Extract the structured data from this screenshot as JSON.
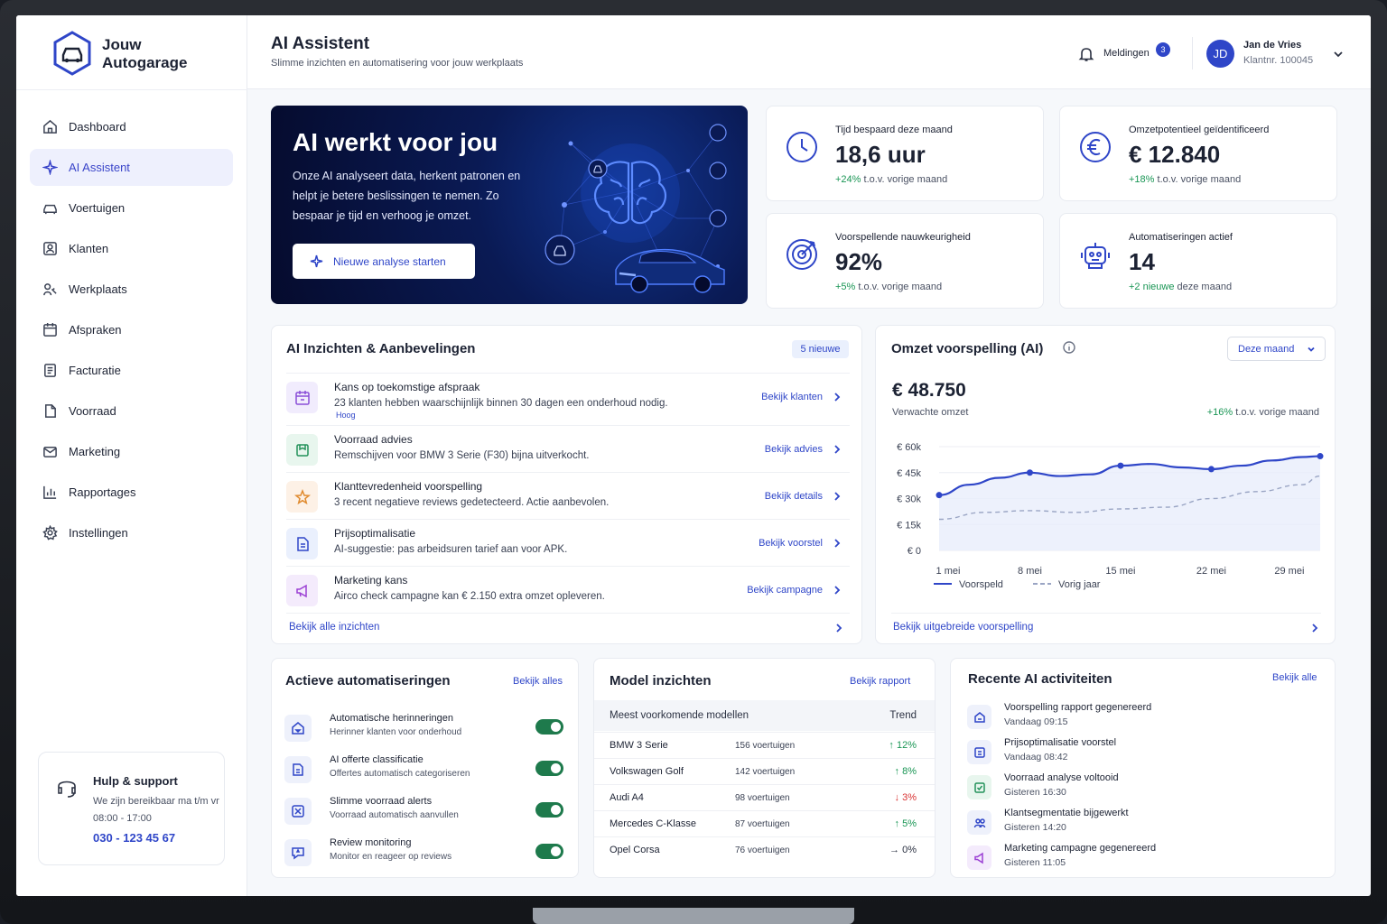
{
  "brand": {
    "line1": "Jouw",
    "line2": "Autogarage"
  },
  "sidebar": {
    "items": [
      {
        "label": "Dashboard",
        "icon": "home-icon"
      },
      {
        "label": "AI Assistent",
        "icon": "sparkle-icon",
        "active": true
      },
      {
        "label": "Voertuigen",
        "icon": "car-icon"
      },
      {
        "label": "Klanten",
        "icon": "customer-card-icon"
      },
      {
        "label": "Werkplaats",
        "icon": "workshop-icon"
      },
      {
        "label": "Afspraken",
        "icon": "calendar-icon"
      },
      {
        "label": "Facturatie",
        "icon": "invoice-icon"
      },
      {
        "label": "Voorraad",
        "icon": "document-icon"
      },
      {
        "label": "Marketing",
        "icon": "mail-icon"
      },
      {
        "label": "Rapportages",
        "icon": "bar-chart-icon"
      },
      {
        "label": "Instellingen",
        "icon": "gear-icon"
      }
    ],
    "help": {
      "title": "Hulp & support",
      "subtitle": "We zijn bereikbaar ma t/m vr 08:00 - 17:00",
      "phone": "030 - 123 45 67"
    }
  },
  "header": {
    "title": "AI Assistent",
    "subtitle": "Slimme inzichten en automatisering voor jouw werkplaats",
    "notifications_label": "Meldingen",
    "notifications_count": "3",
    "user": {
      "initials": "JD",
      "name": "Jan de Vries",
      "customer_no": "Klantnr. 100045"
    }
  },
  "hero": {
    "title": "AI werkt voor jou",
    "text": "Onze AI analyseert data, herkent patronen en helpt je betere beslissingen te nemen. Zo bespaar je tijd en verhoog je omzet.",
    "button": "Nieuwe analyse starten"
  },
  "kpis": [
    {
      "label": "Tijd bespaard deze maand",
      "value": "18,6 uur",
      "delta": "+24%",
      "delta_rest": " t.o.v. vorige maand",
      "icon": "clock-icon"
    },
    {
      "label": "Omzetpotentieel geïdentificeerd",
      "value": "€ 12.840",
      "delta": "+18%",
      "delta_rest": " t.o.v. vorige maand",
      "icon": "euro-icon"
    },
    {
      "label": "Voorspellende nauwkeurigheid",
      "value": "92%",
      "delta": "+5%",
      "delta_rest": " t.o.v. vorige maand",
      "icon": "target-icon"
    },
    {
      "label": "Automatiseringen actief",
      "value": "14",
      "delta": "+2 nieuwe",
      "delta_rest": " deze maand",
      "icon": "robot-icon"
    }
  ],
  "insights": {
    "title": "AI Inzichten & Aanbevelingen",
    "badge": "5 nieuwe",
    "items": [
      {
        "title": "Kans op toekomstige afspraak",
        "desc": "23 klanten hebben waarschijnlijk binnen 30 dagen een onderhoud nodig.",
        "tag": "Hoog",
        "link": "Bekijk klanten",
        "icon": "calendar-icon"
      },
      {
        "title": "Voorraad advies",
        "desc": "Remschijven voor BMW 3 Serie (F30) bijna uitverkocht.",
        "tag": "",
        "link": "Bekijk advies",
        "icon": "box-icon"
      },
      {
        "title": "Klanttevredenheid voorspelling",
        "desc": "3 recent negatieve reviews gedetecteerd. Actie aanbevolen.",
        "tag": "",
        "link": "Bekijk details",
        "icon": "star-icon"
      },
      {
        "title": "Prijsoptimalisatie",
        "desc": "AI-suggestie: pas arbeidsuren tarief aan voor APK.",
        "tag": "",
        "link": "Bekijk voorstel",
        "icon": "price-tag-icon"
      },
      {
        "title": "Marketing kans",
        "desc": "Airco check campagne kan € 2.150 extra omzet opleveren.",
        "tag": "",
        "link": "Bekijk campagne",
        "icon": "megaphone-icon"
      }
    ],
    "footer_link": "Bekijk alle inzichten"
  },
  "forecast": {
    "title": "Omzet voorspelling (AI)",
    "period": "Deze maand",
    "value": "€ 48.750",
    "sub": "Verwachte omzet",
    "delta": "+16%",
    "delta_rest": " t.o.v. vorige maand",
    "footer_link": "Bekijk uitgebreide voorspelling"
  },
  "chart_data": {
    "type": "line",
    "x": [
      "1 mei",
      "8 mei",
      "15 mei",
      "22 mei",
      "29 mei"
    ],
    "yticks": [
      "€ 0",
      "€ 15k",
      "€ 30k",
      "€ 45k",
      "€ 60k"
    ],
    "ylim": [
      0,
      60000
    ],
    "series": [
      {
        "name": "Voorspeld",
        "x": [
          0,
          0.33,
          0.67,
          1,
          1.33,
          1.67,
          2,
          2.33,
          2.67,
          3,
          3.33,
          3.67,
          4,
          4.2
        ],
        "values": [
          32000,
          38000,
          42000,
          45000,
          43000,
          44000,
          49000,
          50000,
          48000,
          47000,
          49000,
          52000,
          54000,
          54500
        ],
        "color": "#2f46c8",
        "markers": [
          0,
          3,
          6,
          9,
          13
        ]
      },
      {
        "name": "Vorig jaar",
        "x": [
          0,
          0.5,
          1,
          1.5,
          2,
          2.5,
          3,
          3.5,
          4,
          4.2
        ],
        "values": [
          18000,
          22000,
          23000,
          22000,
          24000,
          25000,
          30000,
          34000,
          38000,
          43000
        ],
        "color": "#9aa5c4",
        "dashed": true
      }
    ],
    "legend": "bottom-left"
  },
  "automations": {
    "title": "Actieve automatiseringen",
    "link": "Bekijk alles",
    "items": [
      {
        "title": "Automatische herinneringen",
        "desc": "Herinner klanten voor onderhoud",
        "icon": "house-bell-icon",
        "on": true
      },
      {
        "title": "AI offerte classificatie",
        "desc": "Offertes automatisch categoriseren",
        "icon": "document-ai-icon",
        "on": true
      },
      {
        "title": "Slimme voorraad alerts",
        "desc": "Voorraad automatisch aanvullen",
        "icon": "stock-alert-icon",
        "on": true
      },
      {
        "title": "Review monitoring",
        "desc": "Monitor en reageer op reviews",
        "icon": "review-icon",
        "on": true
      }
    ]
  },
  "models": {
    "title": "Model inzichten",
    "link": "Bekijk rapport",
    "col_model": "Meest voorkomende modellen",
    "col_trend": "Trend",
    "rows": [
      {
        "name": "BMW 3 Serie",
        "count": "156 voertuigen",
        "trend": "↑ 12%",
        "dir": "up"
      },
      {
        "name": "Volkswagen Golf",
        "count": "142 voertuigen",
        "trend": "↑ 8%",
        "dir": "up"
      },
      {
        "name": "Audi A4",
        "count": "98 voertuigen",
        "trend": "↓ 3%",
        "dir": "down"
      },
      {
        "name": "Mercedes C-Klasse",
        "count": "87 voertuigen",
        "trend": "↑ 5%",
        "dir": "up"
      },
      {
        "name": "Opel Corsa",
        "count": "76 voertuigen",
        "trend": "→ 0%",
        "dir": "flat"
      }
    ]
  },
  "activities": {
    "title": "Recente AI activiteiten",
    "link": "Bekijk alle",
    "items": [
      {
        "title": "Voorspelling rapport gegenereerd",
        "time": "Vandaag 09:15",
        "icon": "report-icon",
        "tone": "blue"
      },
      {
        "title": "Prijsoptimalisatie voorstel",
        "time": "Vandaag 08:42",
        "icon": "price-icon",
        "tone": "blue"
      },
      {
        "title": "Voorraad analyse voltooid",
        "time": "Gisteren 16:30",
        "icon": "box-check-icon",
        "tone": "green"
      },
      {
        "title": "Klantsegmentatie bijgewerkt",
        "time": "Gisteren 14:20",
        "icon": "users-icon",
        "tone": "blue"
      },
      {
        "title": "Marketing campagne gegenereerd",
        "time": "Gisteren 11:05",
        "icon": "megaphone-icon",
        "tone": "purple"
      }
    ]
  }
}
